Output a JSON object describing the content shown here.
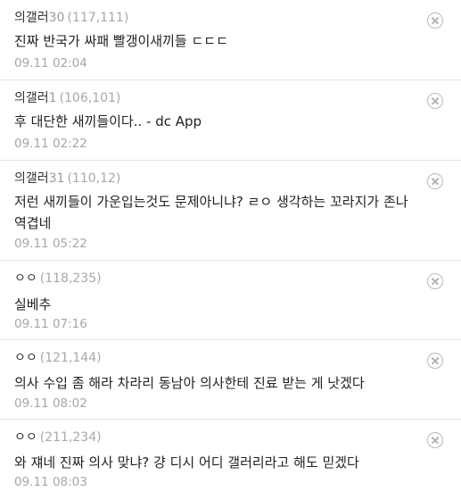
{
  "comments": [
    {
      "nickname": "의갤러",
      "level": "30",
      "ip": "(117,111)",
      "text": "진짜 반국가 싸패 빨갱이새끼들 ㄷㄷㄷ",
      "timestamp": "09.11 02:04",
      "delete_icon": "close-circle-icon"
    },
    {
      "nickname": "의갤러",
      "level": "1",
      "ip": "(106,101)",
      "text": "후 대단한 새끼들이다.. - dc App",
      "timestamp": "09.11 02:22",
      "delete_icon": "close-circle-icon"
    },
    {
      "nickname": "의갤러",
      "level": "31",
      "ip": "(110,12)",
      "text": "저런 새끼들이 가운입는것도 문제아니냐? ㄹㅇ 생각하는 꼬라지가 존나 역겹네",
      "timestamp": "09.11 05:22",
      "delete_icon": "close-circle-icon"
    },
    {
      "nickname": "ㅇㅇ",
      "level": "",
      "ip": "(118,235)",
      "text": "실베추",
      "timestamp": "09.11 07:16",
      "delete_icon": "close-circle-icon"
    },
    {
      "nickname": "ㅇㅇ",
      "level": "",
      "ip": "(121,144)",
      "text": "의사 수입 좀 해라 차라리 동남아 의사한테 진료 받는 게 낫겠다",
      "timestamp": "09.11 08:02",
      "delete_icon": "close-circle-icon"
    },
    {
      "nickname": "ㅇㅇ",
      "level": "",
      "ip": "(211,234)",
      "text": "와 쟤네 진짜 의사 맞냐? 걍 디시 어디 갤러리라고 해도 믿겠다",
      "timestamp": "09.11 08:03",
      "delete_icon": "close-circle-icon"
    }
  ]
}
